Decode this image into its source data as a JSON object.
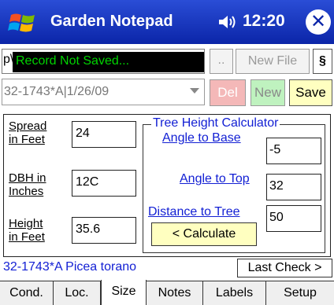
{
  "titlebar": {
    "app_title": "Garden Notepad",
    "clock": "12:20",
    "close_glyph": "✕",
    "icons": [
      "windows-logo-icon",
      "speaker-icon",
      "close-icon"
    ]
  },
  "file": {
    "filename_fragment": "p\\t",
    "status_message": "Record Not Saved...",
    "browse_label": "..",
    "new_file_label": "New File",
    "section_label": "§"
  },
  "record": {
    "selected": "32-1743*A|1/26/09",
    "delete_label": "Del",
    "new_label": "New",
    "save_label": "Save"
  },
  "fields": {
    "spread_label_1": "Spread",
    "spread_label_2": "in Feet",
    "spread_value": "24",
    "dbh_label_1": "DBH in",
    "dbh_label_2": "Inches",
    "dbh_value": "12C",
    "height_label_1": "Height",
    "height_label_2": "in Feet",
    "height_value": "35.6"
  },
  "calculator": {
    "legend": "Tree Height Calculator",
    "angle_base_label": "Angle to Base",
    "angle_base_value": "-5",
    "angle_top_label": "Angle to Top",
    "angle_top_value": "32",
    "distance_label": "Distance to Tree",
    "distance_value": "50",
    "calculate_label": "< Calculate"
  },
  "status": {
    "species": "32-1743*A Picea torano",
    "last_check_label": "Last Check >"
  },
  "tabs": [
    {
      "label": "Cond."
    },
    {
      "label": "Loc."
    },
    {
      "label": "Size"
    },
    {
      "label": "Notes"
    },
    {
      "label": "Labels"
    },
    {
      "label": "Setup"
    }
  ],
  "active_tab": "Size",
  "colors": {
    "titlebar": "#0b25a8",
    "status_text": "#00d400",
    "link": "#1320d4",
    "save_bg": "#ffffc0",
    "delete_bg": "#f4b8b8",
    "new_bg": "#bff2bf"
  }
}
